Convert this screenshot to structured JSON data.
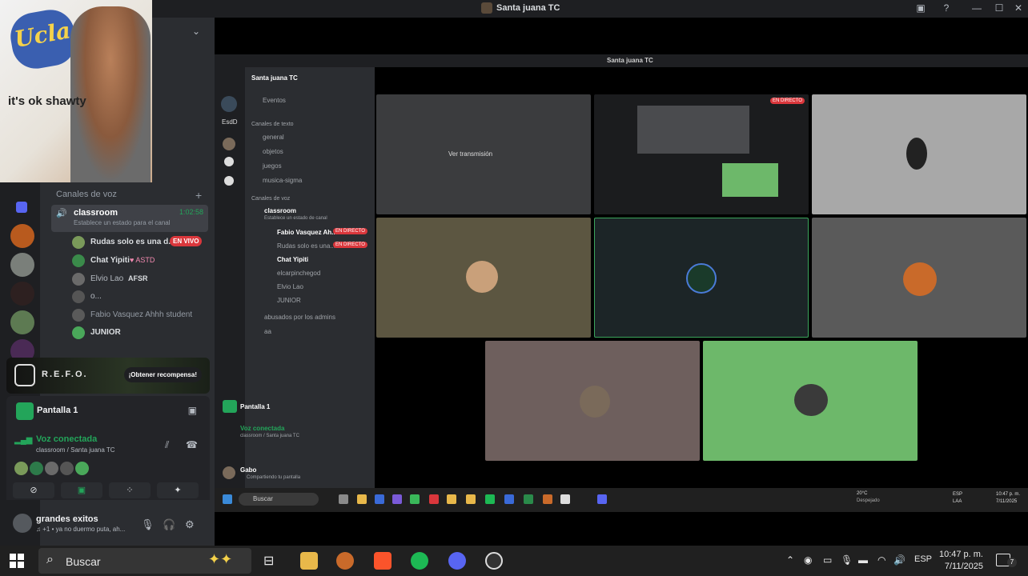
{
  "window": {
    "title": "Santa juana TC",
    "controls": [
      "—",
      "☐",
      "✕"
    ]
  },
  "webcam": {
    "logo_text": "Ucla Bruins",
    "caption": "it's ok shawty"
  },
  "voice_channels": {
    "header": "Canales de voz",
    "add": "+",
    "active": {
      "name": "classroom",
      "timer": "1:02:58",
      "status": "Establece un estado para el canal"
    },
    "members": [
      {
        "name": "Rudas solo es una d...",
        "badge": "EN VIVO",
        "tag": ""
      },
      {
        "name": "Chat Yipiti",
        "badge": "",
        "tag": "♥ ASTD"
      },
      {
        "name": "Elvio Lao",
        "badge": "",
        "tag": "AFSR"
      },
      {
        "name": "o...",
        "badge": "",
        "tag": ""
      },
      {
        "name": "Fabio Vasquez Ahhh student",
        "badge": "",
        "tag": ""
      },
      {
        "name": "JUNIOR",
        "badge": "",
        "tag": ""
      }
    ]
  },
  "promo": {
    "title": "R.E.F.O.",
    "button": "¡Obtener recompensa!"
  },
  "screen_share": {
    "label": "Pantalla 1"
  },
  "voice_status": {
    "connected": "Voz conectada",
    "location": "classroom / Santa juana TC"
  },
  "control_buttons": [
    "⊘",
    "▣",
    "⁘",
    "✦"
  ],
  "user": {
    "name": "grandes exitos",
    "status": "♫ +1 • ya no duermo puta, ah..."
  },
  "stream": {
    "title": "Santa juana TC",
    "server": "Santa juana TC",
    "rail_label": "EsdD",
    "events": "Eventos",
    "text_header": "Canales de texto",
    "text_channels": [
      "general",
      "objetos",
      "juegos",
      "musica-sigma"
    ],
    "voice_header": "Canales de voz",
    "channel": "classroom",
    "channel_status": "Establece un estado de canal",
    "members": [
      {
        "name": "Fabio Vasquez Ah...",
        "live": "EN DIRECTO"
      },
      {
        "name": "Rudas solo es una...",
        "live": "EN DIRECTO"
      },
      {
        "name": "Chat Yipiti",
        "live": ""
      },
      {
        "name": "elcarpinchegod",
        "live": ""
      },
      {
        "name": "Elvio Lao",
        "live": ""
      },
      {
        "name": "JUNIOR",
        "live": ""
      }
    ],
    "other_channels": [
      "abusados por los admins",
      "aa"
    ],
    "watch_stream": "Ver transmisión",
    "live_badge": "EN DIRECTO",
    "screen_label": "Pantalla 1",
    "voice_connected": "Voz conectada",
    "voice_location": "classroom / Santa juana TC",
    "user_name": "Gabo",
    "user_status": "Compartiendo tu pantalla",
    "taskbar_search": "Buscar",
    "weather_temp": "20°C",
    "weather_desc": "Despejado",
    "lang": "ESP",
    "lang2": "LAA",
    "time": "10:47 p. m.",
    "date": "7/11/2025"
  },
  "taskbar": {
    "search_placeholder": "Buscar",
    "language": "ESP",
    "time": "10:47 p. m.",
    "date": "7/11/2025",
    "notifications": "7"
  }
}
